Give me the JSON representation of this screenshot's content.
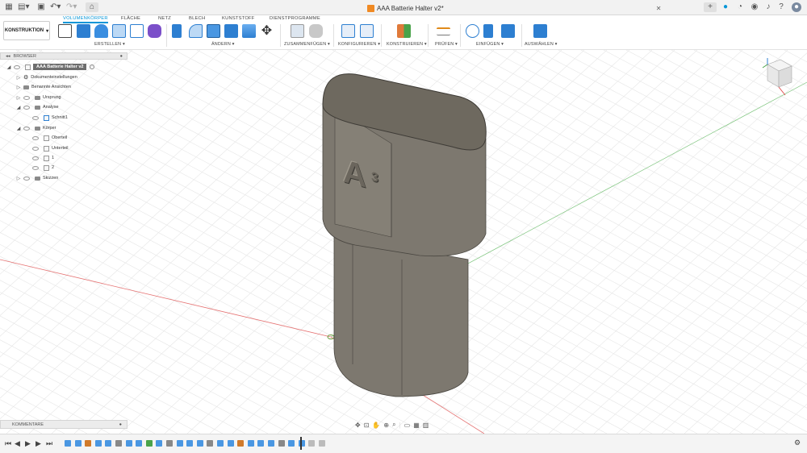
{
  "title_bar": {
    "document_title": "AAA Batterie Halter v2*"
  },
  "workspace_button": {
    "label": "KONSTRUKTION",
    "chevron": "▾"
  },
  "tabs": [
    {
      "label": "VOLUMENKÖRPER",
      "active": true
    },
    {
      "label": "FLÄCHE",
      "active": false
    },
    {
      "label": "NETZ",
      "active": false
    },
    {
      "label": "BLECH",
      "active": false
    },
    {
      "label": "KUNSTSTOFF",
      "active": false
    },
    {
      "label": "DIENSTPROGRAMME",
      "active": false
    }
  ],
  "toolbar_groups": [
    {
      "label": "ERSTELLEN ▾"
    },
    {
      "label": "ÄNDERN ▾"
    },
    {
      "label": "ZUSAMMENFÜGEN ▾"
    },
    {
      "label": "KONFIGURIEREN ▾"
    },
    {
      "label": "KONSTRUIEREN ▾"
    },
    {
      "label": "PRÜFEN ▾"
    },
    {
      "label": "EINFÜGEN ▾"
    },
    {
      "label": "AUSWÄHLEN ▾"
    }
  ],
  "browser": {
    "header": "BROWSER",
    "root": "AAA Batterie Halter v2",
    "items": [
      {
        "label": "Dokumenteinstellungen"
      },
      {
        "label": "Benannte Ansichten"
      },
      {
        "label": "Ursprung"
      },
      {
        "label": "Analyse"
      },
      {
        "label": "Schnitt1"
      },
      {
        "label": "Körper"
      },
      {
        "label": "Oberteil"
      },
      {
        "label": "Unterteil"
      },
      {
        "label": "1"
      },
      {
        "label": "2"
      },
      {
        "label": "Skizzen"
      }
    ]
  },
  "comments": {
    "label": "KOMMENTARE"
  },
  "model": {
    "engraving": "A",
    "engraving_sub": "3"
  },
  "colors": {
    "accent": "#0696d7",
    "model_body": "#7d786f",
    "model_dark": "#5f5b54",
    "grid_line": "#e4e4e4",
    "axis_red": "#e57373",
    "axis_green": "#7cc47c"
  }
}
